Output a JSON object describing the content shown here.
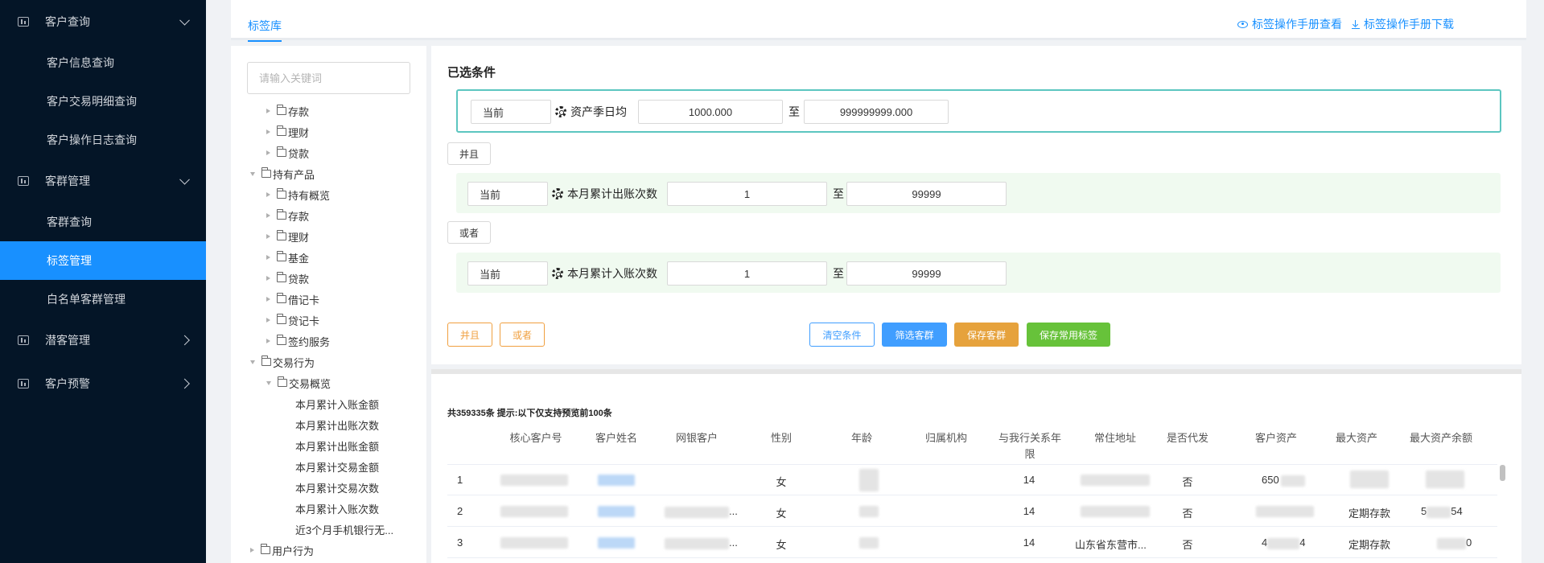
{
  "sidebar": {
    "groups": [
      {
        "label": "客户查询",
        "items": [
          "客户信息查询",
          "客户交易明细查询",
          "客户操作日志查询"
        ]
      },
      {
        "label": "客群管理",
        "items": [
          "客群查询",
          "标签管理",
          "白名单客群管理"
        ]
      },
      {
        "label": "潜客管理"
      },
      {
        "label": "客户预警"
      }
    ],
    "active_item": "标签管理"
  },
  "header": {
    "tab": "标签库",
    "link_view": "标签操作手册查看",
    "link_download": "标签操作手册下载"
  },
  "tree": {
    "search_placeholder": "请输入关键词",
    "nodes": [
      {
        "label": "存款",
        "level": 1,
        "caret": "right"
      },
      {
        "label": "理财",
        "level": 1,
        "caret": "right"
      },
      {
        "label": "贷款",
        "level": 1,
        "caret": "right"
      },
      {
        "label": "持有产品",
        "level": 0,
        "caret": "down"
      },
      {
        "label": "持有概览",
        "level": 1,
        "caret": "right"
      },
      {
        "label": "存款",
        "level": 1,
        "caret": "right"
      },
      {
        "label": "理财",
        "level": 1,
        "caret": "right"
      },
      {
        "label": "基金",
        "level": 1,
        "caret": "right"
      },
      {
        "label": "贷款",
        "level": 1,
        "caret": "right"
      },
      {
        "label": "借记卡",
        "level": 1,
        "caret": "right"
      },
      {
        "label": "贷记卡",
        "level": 1,
        "caret": "right"
      },
      {
        "label": "签约服务",
        "level": 1,
        "caret": "right"
      },
      {
        "label": "交易行为",
        "level": 0,
        "caret": "down"
      },
      {
        "label": "交易概览",
        "level": 1,
        "caret": "down"
      },
      {
        "label": "本月累计入账金额",
        "level": 2
      },
      {
        "label": "本月累计出账次数",
        "level": 2
      },
      {
        "label": "本月累计出账金额",
        "level": 2
      },
      {
        "label": "本月累计交易金额",
        "level": 2
      },
      {
        "label": "本月累计交易次数",
        "level": 2
      },
      {
        "label": "本月累计入账次数",
        "level": 2
      },
      {
        "label": "近3个月手机银行无...",
        "level": 2
      },
      {
        "label": "用户行为",
        "level": 0,
        "caret": "right"
      }
    ]
  },
  "conditions": {
    "title": "已选条件",
    "to_label": "至",
    "rows": [
      {
        "period": "当前",
        "name": "资产季日均",
        "min": "1000.000",
        "max": "999999999.000"
      },
      {
        "period": "当前",
        "name": "本月累计出账次数",
        "min": "1",
        "max": "99999"
      },
      {
        "period": "当前",
        "name": "本月累计入账次数",
        "min": "1",
        "max": "99999"
      }
    ],
    "connectors": [
      "并且",
      "或者"
    ],
    "add_and": "并且",
    "add_or": "或者",
    "btn_clear": "清空条件",
    "btn_filter": "筛选客群",
    "btn_save_group": "保存客群",
    "btn_save_tag": "保存常用标签"
  },
  "results": {
    "summary": "共359335条 提示:以下仅支持预览前100条",
    "headers": [
      "核心客户号",
      "客户姓名",
      "网银客户",
      "性别",
      "年龄",
      "归属机构",
      "与我行关系年限",
      "常住地址",
      "是否代发",
      "客户资产",
      "最大资产",
      "最大资产余额"
    ],
    "rows": [
      {
        "no": "1",
        "gender": "女",
        "years": "14",
        "payroll": "否",
        "assets": "650",
        "max_asset": "",
        "web": "",
        "address": ""
      },
      {
        "no": "2",
        "gender": "女",
        "years": "14",
        "payroll": "否",
        "assets": "",
        "max_asset": "定期存款",
        "web": "...",
        "address": "",
        "max_balance_a": "5",
        "max_balance_b": "54"
      },
      {
        "no": "3",
        "gender": "女",
        "years": "14",
        "payroll": "否",
        "assets_a": "4",
        "assets_b": "4",
        "max_asset": "定期存款",
        "web": "...",
        "address": "山东省东营市...",
        "max_balance": "0"
      }
    ]
  }
}
